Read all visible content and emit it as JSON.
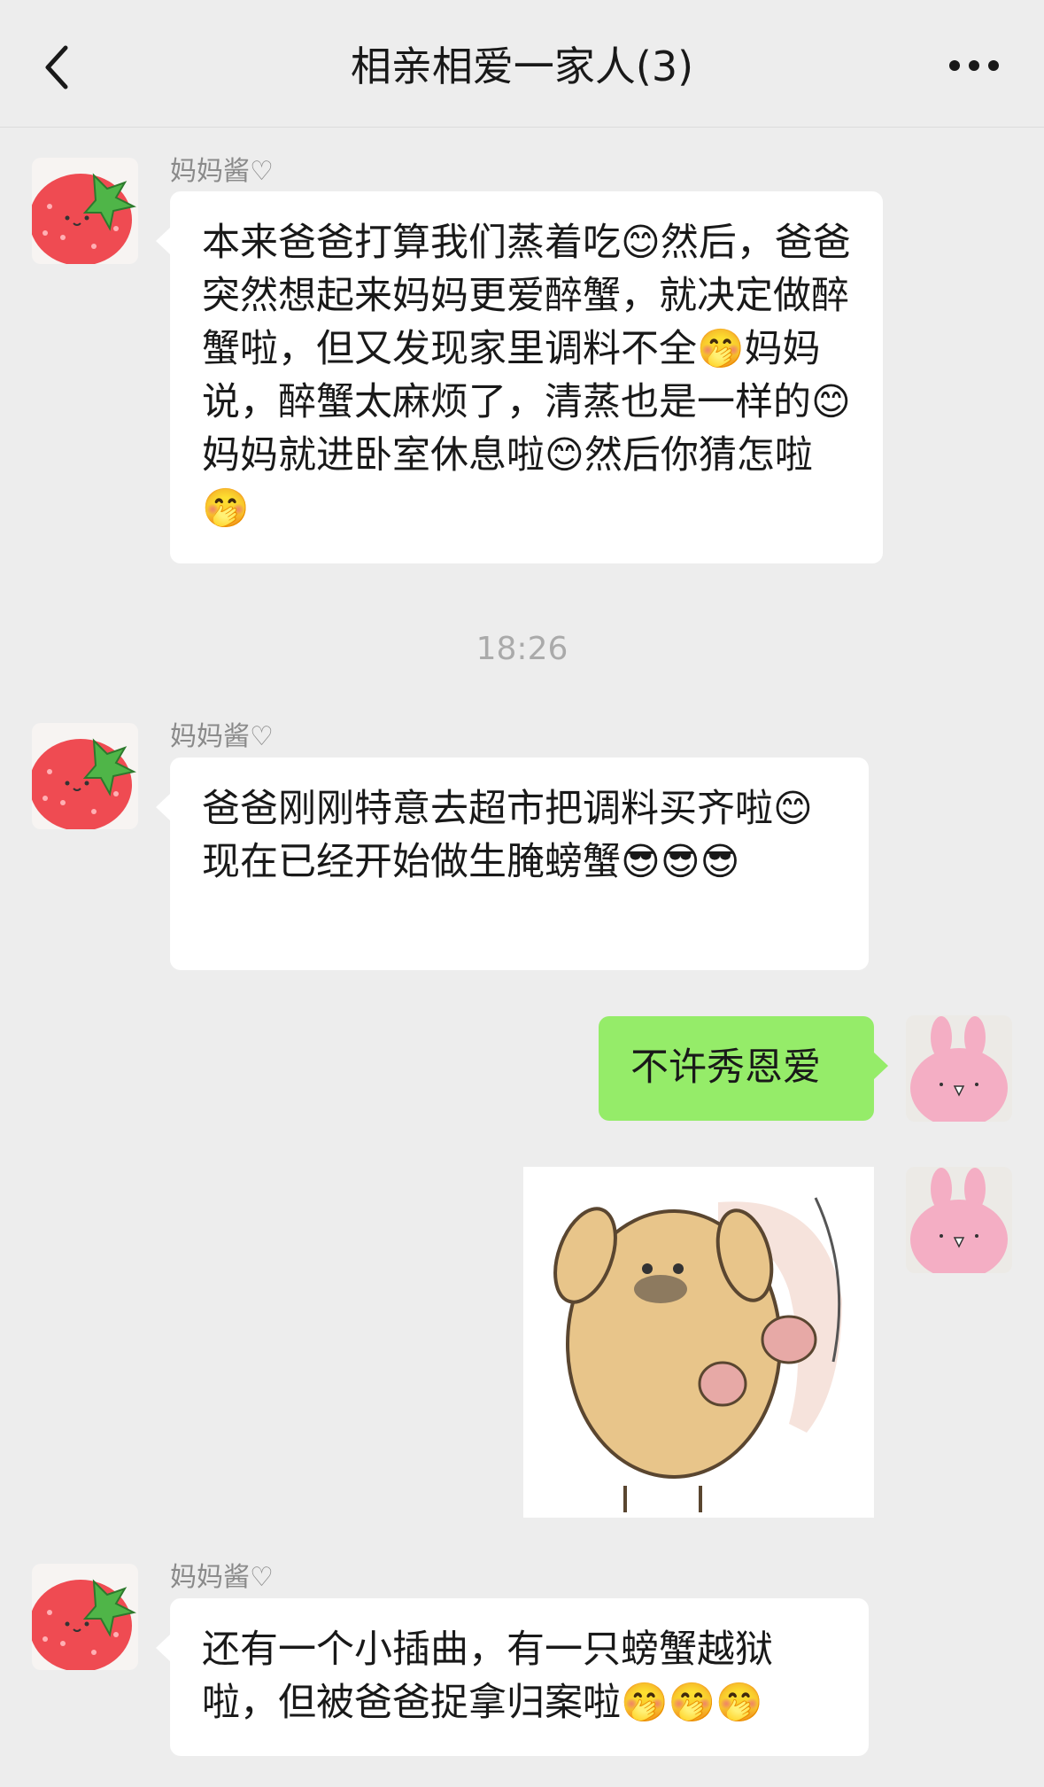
{
  "header": {
    "title": "相亲相爱一家人(3)",
    "back_icon": "chevron-left-icon",
    "more_icon": "ellipsis-icon"
  },
  "messages": [
    {
      "sender": "妈妈酱♡",
      "text": "本来爸爸打算我们蒸着吃😊然后，爸爸突然想起来妈妈更爱醉蟹，就决定做醉蟹啦，但又发现家里调料不全🤭妈妈说，醉蟹太麻烦了，清蒸也是一样的😊妈妈就进卧室休息啦😊然后你猜怎啦🤭"
    },
    {
      "sender": "妈妈酱♡",
      "text": "爸爸刚刚特意去超市把调料买齐啦😊现在已经开始做生腌螃蟹😎😎😎"
    },
    {
      "sender": "me",
      "text": "不许秀恩爱"
    },
    {
      "sender": "me",
      "sticker": "dog-sticker"
    },
    {
      "sender": "妈妈酱♡",
      "text": "还有一个小插曲，有一只螃蟹越狱啦，但被爸爸捉拿归案啦🤭🤭🤭"
    }
  ],
  "timestamp": "18:26",
  "colors": {
    "background": "#ededed",
    "bubble_left": "#ffffff",
    "bubble_right": "#95ec69"
  }
}
